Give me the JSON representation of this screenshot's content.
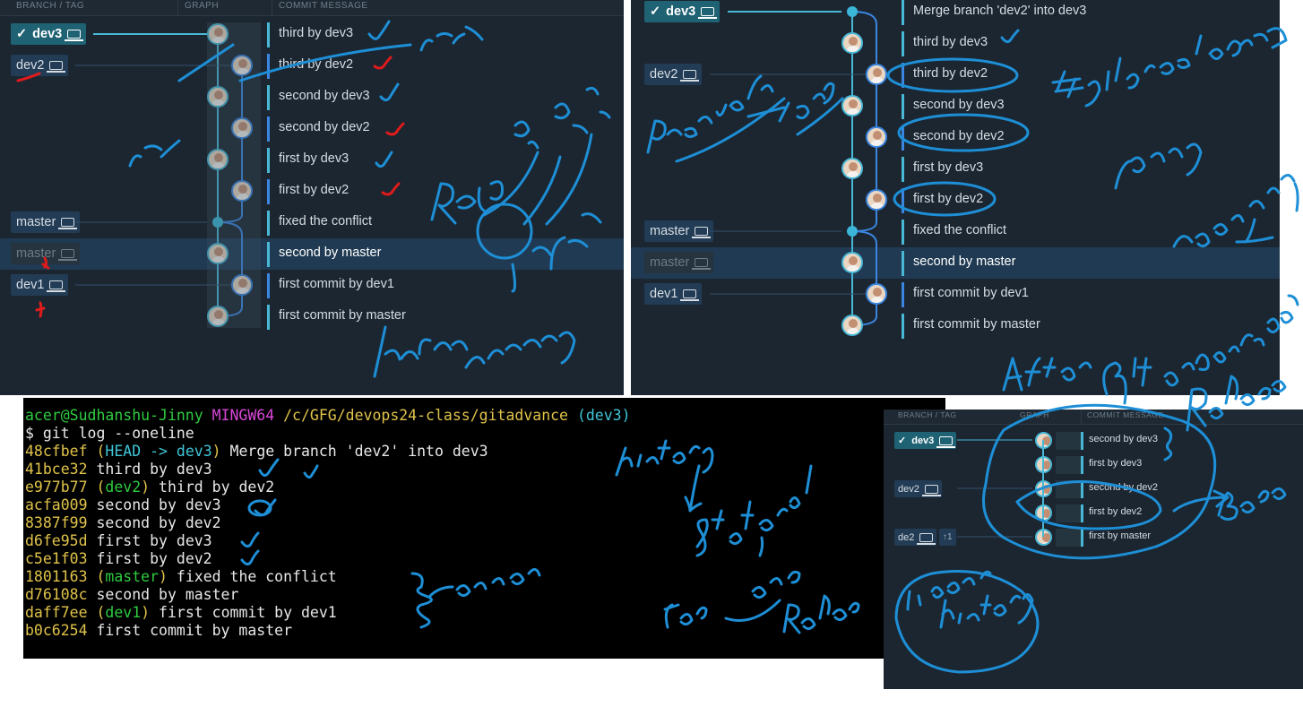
{
  "panel_before": {
    "headers": {
      "branch": "BRANCH / TAG",
      "graph": "GRAPH",
      "message": "COMMIT MESSAGE"
    },
    "branches": [
      {
        "label": "dev3",
        "checked": true,
        "style": "head"
      },
      {
        "label": "dev2",
        "checked": false,
        "style": "normal"
      },
      {
        "label": "master",
        "checked": false,
        "style": "normal"
      },
      {
        "label": "master",
        "checked": false,
        "style": "dim"
      },
      {
        "label": "dev1",
        "checked": false,
        "style": "normal"
      }
    ],
    "commits": [
      {
        "message": "third by dev3",
        "lane": "dev3"
      },
      {
        "message": "third by dev2",
        "lane": "dev2"
      },
      {
        "message": "second by dev3",
        "lane": "dev3"
      },
      {
        "message": "second by dev2",
        "lane": "dev2"
      },
      {
        "message": "first by dev3",
        "lane": "dev3"
      },
      {
        "message": "first by dev2",
        "lane": "dev2"
      },
      {
        "message": "fixed the conflict",
        "lane": "merge"
      },
      {
        "message": "second by master",
        "lane": "dev3",
        "selected": true
      },
      {
        "message": "first commit by dev1",
        "lane": "dev2"
      },
      {
        "message": "first commit by master",
        "lane": "dev3"
      }
    ]
  },
  "panel_after": {
    "branches": [
      {
        "label": "dev3",
        "checked": true,
        "style": "head"
      },
      {
        "label": "dev2",
        "checked": false,
        "style": "normal"
      },
      {
        "label": "master",
        "checked": false,
        "style": "normal"
      },
      {
        "label": "master",
        "checked": false,
        "style": "dim"
      },
      {
        "label": "dev1",
        "checked": false,
        "style": "normal"
      }
    ],
    "commits": [
      {
        "message": "Merge branch 'dev2' into dev3",
        "lane": "merge"
      },
      {
        "message": "third by dev3",
        "lane": "dev3"
      },
      {
        "message": "third by dev2",
        "lane": "dev2"
      },
      {
        "message": "second by dev3",
        "lane": "dev3"
      },
      {
        "message": "second by dev2",
        "lane": "dev2"
      },
      {
        "message": "first by dev3",
        "lane": "dev3"
      },
      {
        "message": "first by dev2",
        "lane": "dev2"
      },
      {
        "message": "fixed the conflict",
        "lane": "merge"
      },
      {
        "message": "second by master",
        "lane": "dev3",
        "selected": true
      },
      {
        "message": "first commit by dev1",
        "lane": "dev2"
      },
      {
        "message": "first commit by master",
        "lane": "dev3"
      }
    ]
  },
  "panel_rebase": {
    "headers": {
      "branch": "BRANCH / TAG",
      "graph": "GRAPH",
      "message": "COMMIT MESSAGE"
    },
    "branches": [
      {
        "label": "dev3",
        "checked": true,
        "style": "head"
      },
      {
        "label": "dev2",
        "checked": false,
        "style": "normal"
      },
      {
        "label": "de2",
        "checked": false,
        "style": "normal",
        "badge": "↑1"
      }
    ],
    "commits": [
      {
        "message": "second by dev3"
      },
      {
        "message": "first by dev3"
      },
      {
        "message": "second by dev2"
      },
      {
        "message": "first by dev2"
      },
      {
        "message": "first by master"
      }
    ]
  },
  "terminal": {
    "prompt": {
      "user": "acer@Sudhanshu-Jinny",
      "system": "MINGW64",
      "path": "/c/GFG/devops24-class/gitadvance",
      "branch": "(dev3)"
    },
    "command": "$ git log --oneline",
    "log": [
      {
        "hash": "48cfbef",
        "ref_open": " (",
        "ref": "HEAD -> dev3",
        "ref_close": ")",
        "msg": " Merge branch 'dev2' into dev3"
      },
      {
        "hash": "41bce32",
        "ref_open": "",
        "ref": "",
        "ref_close": "",
        "msg": " third by dev3"
      },
      {
        "hash": "e977b77",
        "ref_open": " (",
        "ref": "dev2",
        "ref_close": ")",
        "msg": " third by dev2"
      },
      {
        "hash": "acfa009",
        "ref_open": "",
        "ref": "",
        "ref_close": "",
        "msg": " second by dev3"
      },
      {
        "hash": "8387f99",
        "ref_open": "",
        "ref": "",
        "ref_close": "",
        "msg": " second by dev2"
      },
      {
        "hash": "d6fe95d",
        "ref_open": "",
        "ref": "",
        "ref_close": "",
        "msg": " first by dev3"
      },
      {
        "hash": "c5e1f03",
        "ref_open": "",
        "ref": "",
        "ref_close": "",
        "msg": " first by dev2"
      },
      {
        "hash": "1801163",
        "ref_open": " (",
        "ref": "master",
        "ref_close": ")",
        "msg": " fixed the conflict"
      },
      {
        "hash": "d76108c",
        "ref_open": "",
        "ref": "",
        "ref_close": "",
        "msg": " second by master"
      },
      {
        "hash": "daff7ee",
        "ref_open": " (",
        "ref": "dev1",
        "ref_close": ")",
        "msg": " first commit by dev1"
      },
      {
        "hash": "b0c6254",
        "ref_open": "",
        "ref": "",
        "ref_close": "",
        "msg": " first commit by master"
      }
    ]
  },
  "annotations": {
    "before_notes": [
      "dev2",
      "dev3",
      "Repo",
      "github",
      "before merging"
    ],
    "after_notes": [
      "preserve",
      "merg",
      "# git merge dev2",
      "merge",
      "code feature",
      "After git rebase dev",
      "Rebase"
    ],
    "terminal_notes": [
      "history",
      "scattered",
      "common",
      "dev dev2",
      "Rebase"
    ],
    "rebase_notes": [
      "base",
      "linear history"
    ],
    "colors": {
      "ink": "#1e8fd6",
      "red_ink": "#e01b1b"
    }
  },
  "theme": {
    "panel_bg": "#1b2631",
    "dev3_lane": "#48b8d6",
    "dev2_lane": "#3a86e0",
    "head_pill": "#1f6273"
  }
}
